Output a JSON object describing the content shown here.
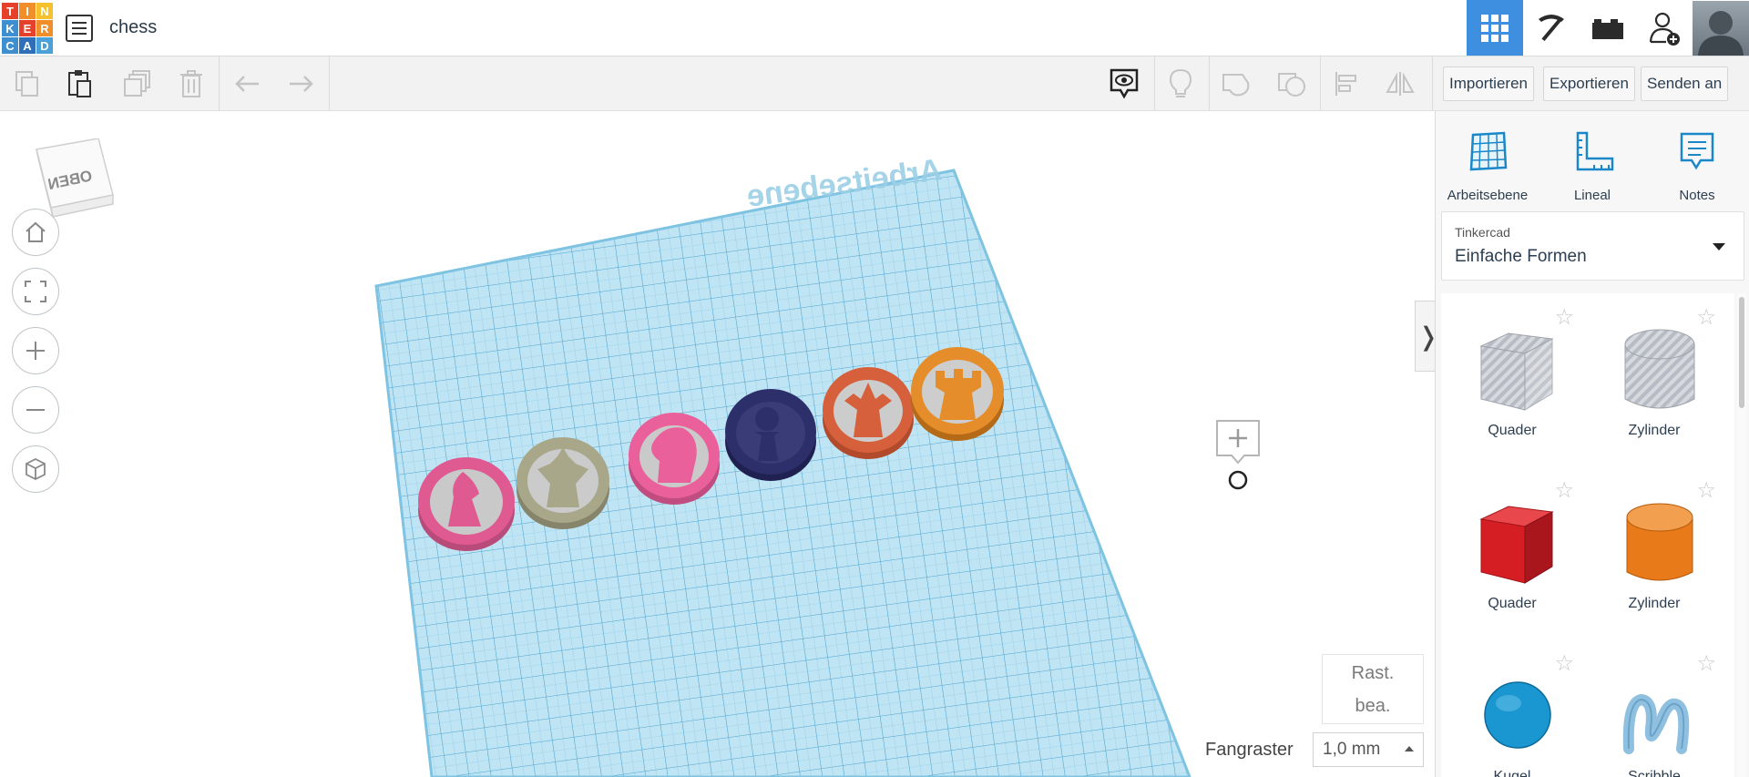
{
  "app": {
    "brand": "Tinkercad",
    "logo_letters": [
      "T",
      "I",
      "N",
      "K",
      "E",
      "R",
      "C",
      "A",
      "D"
    ],
    "logo_colors": [
      "#e6402b",
      "#f08f2a",
      "#f5c22e",
      "#3d8fcf",
      "#e6402b",
      "#f08f2a",
      "#3d8fcf",
      "#2e6fb8",
      "#4aa0d8"
    ]
  },
  "header": {
    "design_title": "chess",
    "design_list_icon": "list-icon",
    "buttons": [
      {
        "name": "3d-view-icon",
        "active": true
      },
      {
        "name": "pickaxe-icon",
        "active": false
      },
      {
        "name": "bricks-icon",
        "active": false
      },
      {
        "name": "add-user-icon",
        "active": false
      }
    ]
  },
  "toolbar": {
    "left_tools": [
      "copy-icon",
      "paste-icon",
      "duplicate-icon",
      "delete-icon",
      "undo-icon",
      "redo-icon"
    ],
    "right_tools": [
      "show-notes-icon",
      "lightbulb-icon",
      "shape-solid-icon",
      "shape-hole-icon",
      "align-icon",
      "mirror-icon"
    ],
    "import_label": "Importieren",
    "export_label": "Exportieren",
    "send_label": "Senden an"
  },
  "viewport": {
    "view_cube_label": "OBEN",
    "workplane_label": "Arbeitsebene",
    "nav_buttons": [
      "home-icon",
      "fit-view-icon",
      "zoom-in-icon",
      "zoom-out-icon",
      "perspective-icon"
    ],
    "pieces": [
      {
        "name": "pink-bishop-piece",
        "color": "#e05a92"
      },
      {
        "name": "khaki-king-piece",
        "color": "#a9a78a"
      },
      {
        "name": "pink-knight-piece",
        "color": "#e9609a"
      },
      {
        "name": "navy-pawn-piece",
        "color": "#2d2f6a"
      },
      {
        "name": "orange-queen-piece",
        "color": "#d6603b"
      },
      {
        "name": "amber-rook-piece",
        "color": "#e48d2a"
      }
    ],
    "edit_grid_line1": "Rast.",
    "edit_grid_line2": "bea.",
    "snap_grid_label": "Fangraster",
    "snap_grid_value": "1,0 mm",
    "panel_toggle": "❭"
  },
  "right_panel": {
    "tools": [
      {
        "label": "Arbeitsebene",
        "icon": "workplane-icon"
      },
      {
        "label": "Lineal",
        "icon": "ruler-icon"
      },
      {
        "label": "Notes",
        "icon": "notes-icon"
      }
    ],
    "library_provider": "Tinkercad",
    "library_value": "Einfache Formen",
    "shapes": [
      {
        "label": "Quader",
        "icon": "box-hole-icon"
      },
      {
        "label": "Zylinder",
        "icon": "cylinder-hole-icon"
      },
      {
        "label": "Quader",
        "icon": "box-icon",
        "color": "#d41e24"
      },
      {
        "label": "Zylinder",
        "icon": "cylinder-icon",
        "color": "#e97a1a"
      },
      {
        "label": "Kugel",
        "icon": "sphere-icon",
        "color": "#1a97d1"
      },
      {
        "label": "Scribble",
        "icon": "scribble-icon",
        "color": "#8fc0e0"
      }
    ]
  }
}
